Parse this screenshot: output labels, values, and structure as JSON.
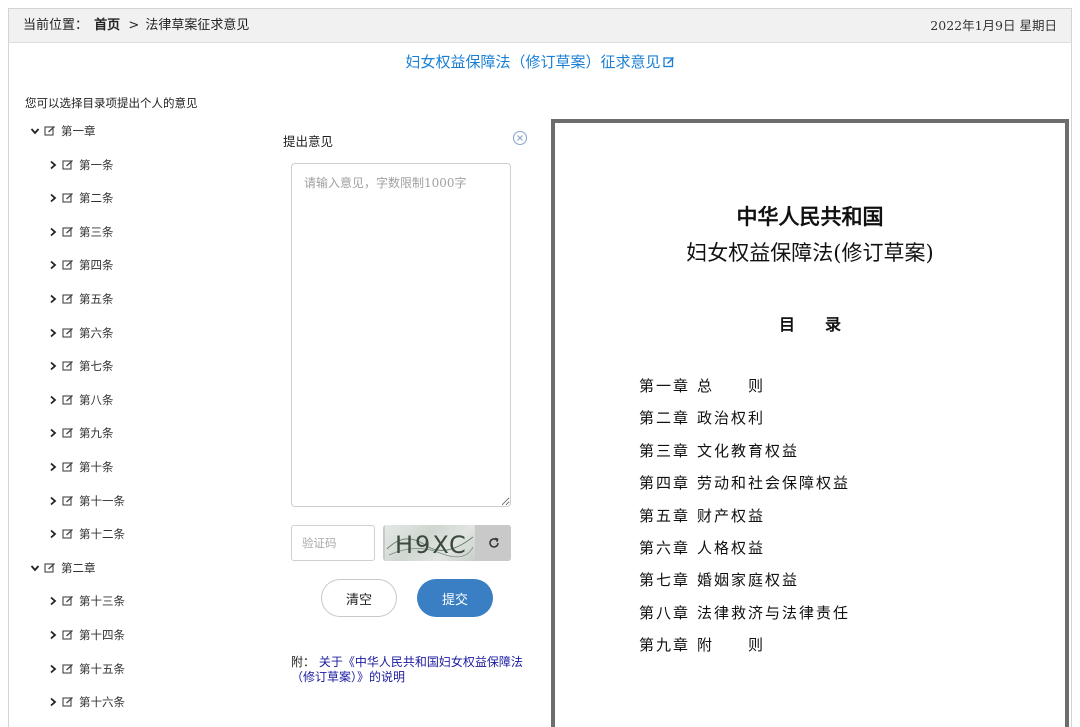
{
  "breadcrumb": {
    "prefix": "当前位置：",
    "home": "首页",
    "separator": ">",
    "current": "法律草案征求意见"
  },
  "date": "2022年1月9日 星期日",
  "page_title": "妇女权益保障法（修订草案）征求意见",
  "hint": "您可以选择目录项提出个人的意见",
  "tree": {
    "chapter1": "第一章",
    "chapter2": "第二章",
    "articles": [
      "第一条",
      "第二条",
      "第三条",
      "第四条",
      "第五条",
      "第六条",
      "第七条",
      "第八条",
      "第九条",
      "第十条",
      "第十一条",
      "第十二条",
      "第十三条",
      "第十四条",
      "第十五条",
      "第十六条"
    ]
  },
  "form": {
    "title": "提出意见",
    "textarea_placeholder": "请输入意见，字数限制1000字",
    "captcha_placeholder": "验证码",
    "captcha_text": "H9XC",
    "clear_label": "清空",
    "submit_label": "提交"
  },
  "note": {
    "prefix": "附：",
    "link": "关于《中华人民共和国妇女权益保障法（修订草案）》的说明"
  },
  "document": {
    "title_line1": "中华人民共和国",
    "title_line2": "妇女权益保障法(修订草案)",
    "toc_label": "目录",
    "chapters": [
      {
        "num": "第一章",
        "name": "总　　则"
      },
      {
        "num": "第二章",
        "name": "政治权利"
      },
      {
        "num": "第三章",
        "name": "文化教育权益"
      },
      {
        "num": "第四章",
        "name": "劳动和社会保障权益"
      },
      {
        "num": "第五章",
        "name": "财产权益"
      },
      {
        "num": "第六章",
        "name": "人格权益"
      },
      {
        "num": "第七章",
        "name": "婚姻家庭权益"
      },
      {
        "num": "第八章",
        "name": "法律救济与法律责任"
      },
      {
        "num": "第九章",
        "name": "附　　则"
      }
    ]
  },
  "colors": {
    "link_blue": "#1a7fd3",
    "submit_blue": "#3a7fc4",
    "doc_border": "#6d6d6d"
  }
}
